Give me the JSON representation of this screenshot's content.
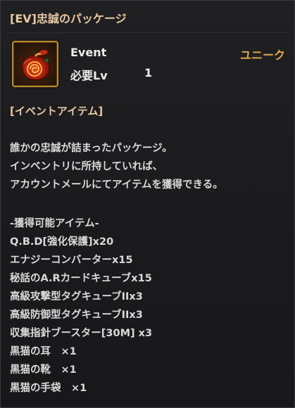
{
  "tooltip": {
    "title": "[EV]忠誠のパッケージ",
    "icon": "red-treasure-pouch-icon",
    "type_label": "Event",
    "rarity": "ユニーク",
    "level_label": "必要Lv",
    "level_value": "1",
    "category": "[イベントアイテム]",
    "description": [
      "誰かの忠誠が詰まったパッケージ。",
      "インベントリに所持していれば、",
      "アカウントメールにてアイテムを獲得できる。"
    ],
    "rewards_header": "-獲得可能アイテム-",
    "rewards": [
      "Q.B.D[強化保護]x20",
      "エナジーコンバーターx15",
      "秘話のA.Rカードキューブx15",
      "高級攻撃型タグキューブIIx3",
      "高級防御型タグキューブIIx3",
      "収集指針ブースター[30M] x3",
      "黒猫の耳　×1",
      "黒猫の靴　×1",
      "黒猫の手袋　×1"
    ]
  },
  "colors": {
    "title": "#e8c9a3",
    "rarity": "#e0a94a",
    "text": "#d9d9d9",
    "background": "#1c1c1e",
    "icon_border": "#b98a2e"
  }
}
